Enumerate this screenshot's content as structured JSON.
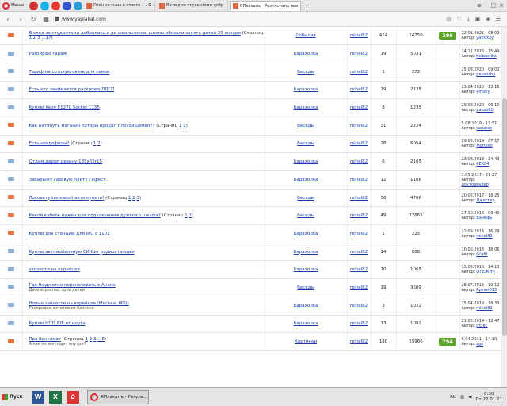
{
  "browser": {
    "menu_label": "Меню",
    "tabs": [
      {
        "title": "Отец за сына в ответе... - Я",
        "active": false
      },
      {
        "title": "В след за студентами добр...",
        "active": false
      },
      {
        "title": "ЯПлакалъ - Результаты пои",
        "active": true
      }
    ],
    "url": "www.yaplakal.com"
  },
  "topics": [
    {
      "icon": "hot",
      "title": "В след за студентами добрались и до школьников, школы обязали занять детей 23 января",
      "pages_prefix": "(Страниц",
      "pages": [
        "1",
        "2",
        "3",
        "...17"
      ],
      "pages_suffix": ")",
      "subtitle": "",
      "forum": "События",
      "author": "mihel82",
      "replies": "414",
      "views": "24750",
      "rating": "286",
      "last_date": "22.01.2021 - 08:09",
      "last_label": "Автор:",
      "last_author": "yatroxxy"
    },
    {
      "icon": "normal",
      "title": "Разбираю гараж",
      "pages_prefix": "",
      "pages": [],
      "pages_suffix": "",
      "subtitle": "",
      "forum": "Барахолка",
      "author": "mihel82",
      "replies": "19",
      "views": "5031",
      "rating": "",
      "last_date": "24.11.2020 - 15:49",
      "last_label": "Автор:",
      "last_author": "Kolbastika"
    },
    {
      "icon": "normal",
      "title": "Тариф на сотовую связь для семьи",
      "pages_prefix": "",
      "pages": [],
      "pages_suffix": "",
      "subtitle": "",
      "forum": "Беседы",
      "author": "mihel82",
      "replies": "1",
      "views": "372",
      "rating": "",
      "last_date": "25.08.2020 - 09:02",
      "last_label": "Автор:",
      "last_author": "pepascha"
    },
    {
      "icon": "normal",
      "title": "Есть кто занимается раскроем ЛДСП",
      "pages_prefix": "",
      "pages": [],
      "pages_suffix": "",
      "subtitle": "",
      "forum": "Барахолка",
      "author": "mihel82",
      "replies": "19",
      "views": "2135",
      "rating": "",
      "last_date": "23.04.2020 - 13:16",
      "last_label": "Автор:",
      "last_author": "emohy"
    },
    {
      "icon": "normal",
      "title": "Куплю Xeon E1270 Socket 1155",
      "pages_prefix": "",
      "pages": [],
      "pages_suffix": "",
      "subtitle": "",
      "forum": "Барахолка",
      "author": "mihel82",
      "replies": "8",
      "views": "1235",
      "rating": "",
      "last_date": "29.03.2020 - 06:10",
      "last_label": "Автор:",
      "last_author": "pasab80"
    },
    {
      "icon": "hot",
      "title": "Как натянуть магазин которы продал плохой цемент?",
      "pages_prefix": "(Страниц",
      "pages": [
        "1",
        "2"
      ],
      "pages_suffix": ")",
      "subtitle": "",
      "forum": "Беседы",
      "author": "mihel82",
      "replies": "31",
      "views": "2224",
      "rating": "",
      "last_date": "5.08.2019 - 11:51",
      "last_label": "Автор:",
      "last_author": "sanaras"
    },
    {
      "icon": "hot",
      "title": "Есть некрофилы?",
      "pages_prefix": "(Страниц",
      "pages": [
        "1",
        "2"
      ],
      "pages_suffix": ")",
      "subtitle": "",
      "forum": "Беседы",
      "author": "mihel82",
      "replies": "28",
      "views": "6054",
      "rating": "",
      "last_date": "29.05.2019 - 07:17",
      "last_label": "Автор:",
      "last_author": "Mortello"
    },
    {
      "icon": "normal",
      "title": "Отдам даром резину 185х65r15",
      "pages_prefix": "",
      "pages": [],
      "pages_suffix": "",
      "subtitle": "",
      "forum": "Барахолка",
      "author": "mihel82",
      "replies": "6",
      "views": "2165",
      "rating": "",
      "last_date": "23.08.2018 - 14:43",
      "last_label": "Автор:",
      "last_author": "KEK84"
    },
    {
      "icon": "normal",
      "title": "Забарыжу газовую плиту Гефест",
      "pages_prefix": "",
      "pages": [],
      "pages_suffix": "",
      "subtitle": "",
      "forum": "Барахолка",
      "author": "mihel82",
      "replies": "12",
      "views": "1108",
      "rating": "",
      "last_date": "7.05.2017 - 21:27",
      "last_label": "Автор:",
      "last_author": "докторвадер"
    },
    {
      "icon": "hot",
      "title": "Посоветуйте какой авто купить!",
      "pages_prefix": "(Страниц",
      "pages": [
        "1",
        "2",
        "3"
      ],
      "pages_suffix": ")",
      "subtitle": "",
      "forum": "Беседы",
      "author": "mihel82",
      "replies": "56",
      "views": "4766",
      "rating": "",
      "last_date": "20.02.2017 - 16:25",
      "last_label": "Автор:",
      "last_author": "Джагтер"
    },
    {
      "icon": "hot",
      "title": "Какой кабель нужен для подключения духового шкафа?",
      "pages_prefix": "(Страниц",
      "pages": [
        "1",
        "2"
      ],
      "pages_suffix": ")",
      "subtitle": "",
      "forum": "Беседы",
      "author": "mihel82",
      "replies": "49",
      "views": "73665",
      "rating": "",
      "last_date": "27.10.2016 - 09:40",
      "last_label": "Автор:",
      "last_author": "Ванёфь"
    },
    {
      "icon": "hot",
      "title": "Куплю док станцию для IRU с 1101",
      "pages_prefix": "",
      "pages": [],
      "pages_suffix": "",
      "subtitle": "",
      "forum": "Барахолка",
      "author": "mihel82",
      "replies": "1",
      "views": "325",
      "rating": "",
      "last_date": "22.09.2016 - 16:29",
      "last_label": "Автор:",
      "last_author": "mihel82"
    },
    {
      "icon": "normal",
      "title": "Куплю автомобильную СИ-Бит радиостанцию",
      "pages_prefix": "",
      "pages": [],
      "pages_suffix": "",
      "subtitle": "",
      "forum": "Барахолка",
      "author": "mihel82",
      "replies": "14",
      "views": "888",
      "rating": "",
      "last_date": "10.06.2016 - 16:06",
      "last_label": "Автор:",
      "last_author": "Grafit"
    },
    {
      "icon": "normal",
      "title": "запчасти на корейцев",
      "pages_prefix": "",
      "pages": [],
      "pages_suffix": "",
      "subtitle": "",
      "forum": "Барахолка",
      "author": "mihel82",
      "replies": "10",
      "views": "1065",
      "rating": "",
      "last_date": "15.05.2016 - 14:13",
      "last_label": "Автор:",
      "last_author": "ОЛЕЖИЧ"
    },
    {
      "icon": "normal",
      "title": "Где бюджетно переночевать в Анапе",
      "pages_prefix": "",
      "pages": [],
      "pages_suffix": "",
      "subtitle": "Двое взрослых трое детей",
      "forum": "Беседы",
      "author": "mihel82",
      "replies": "19",
      "views": "3609",
      "rating": "",
      "last_date": "28.07.2015 - 10:12",
      "last_label": "Автор:",
      "last_author": "Артем813"
    },
    {
      "icon": "normal",
      "title": "Новые запчасти на корейцев (Москва, МО))",
      "pages_prefix": "",
      "pages": [],
      "pages_suffix": "",
      "subtitle": "Распродаю остатки от бизнеса",
      "forum": "Барахолка",
      "author": "mihel82",
      "replies": "3",
      "views": "1022",
      "rating": "",
      "last_date": "15.04.2019 - 16:33",
      "last_label": "Автор:",
      "last_author": "mihel82"
    },
    {
      "icon": "normal",
      "title": "Куплю HDD IDE от ноута",
      "pages_prefix": "",
      "pages": [],
      "pages_suffix": "",
      "subtitle": "",
      "forum": "Барахолка",
      "author": "mihel82",
      "replies": "13",
      "views": "1092",
      "rating": "",
      "last_date": "21.05.2014 - 12:47",
      "last_label": "Автор:",
      "last_author": "ghrec"
    },
    {
      "icon": "hot",
      "title": "Про банкомат",
      "pages_prefix": "(Страниц",
      "pages": [
        "1",
        "2",
        "3",
        "...8"
      ],
      "pages_suffix": ")",
      "subtitle": "А как он выглядит внутри?",
      "forum": "Картинки",
      "author": "mihel82",
      "replies": "180",
      "views": "59966",
      "rating": "794",
      "last_date": "6.04.2011 - 14:10",
      "last_label": "Автор:",
      "last_author": "zgo"
    }
  ],
  "taskbar": {
    "start_label": "Пуск",
    "window_title": "ЯПлакалъ - Резуль...",
    "lang": "RU",
    "time": "8:30",
    "date": "Пт 22.01.21"
  },
  "colors": {
    "hot_icon": "#e8743c",
    "normal_icon": "#8aaed6",
    "rating": "#5aa52a",
    "link": "#1a3ea8"
  }
}
